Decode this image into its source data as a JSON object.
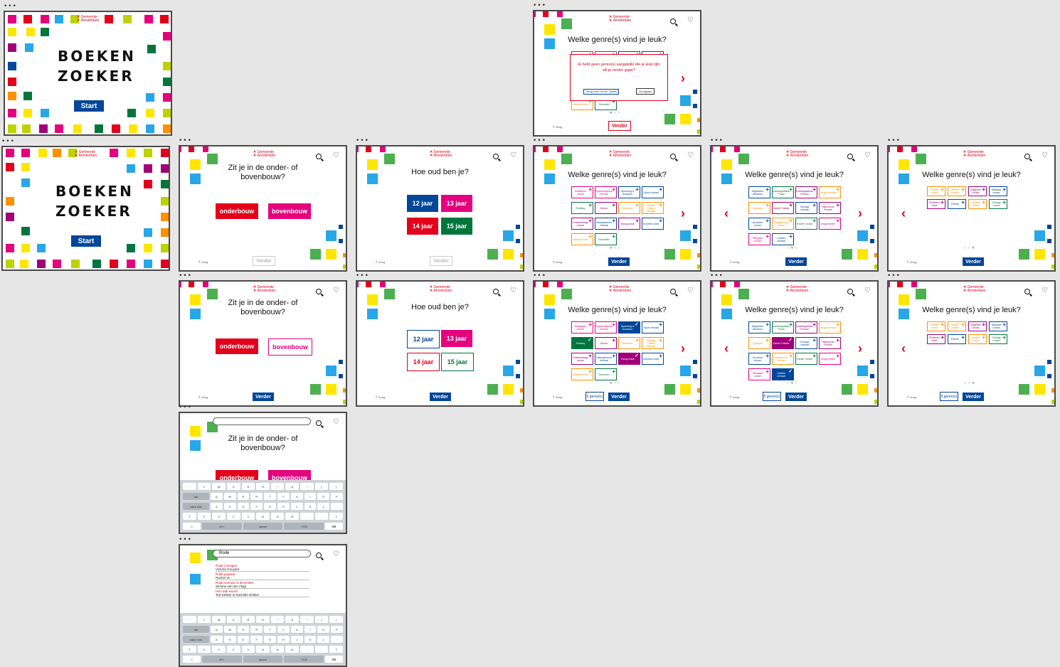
{
  "colors": {
    "red": "#e3001b",
    "blue": "#004699",
    "pink": "#e5007d",
    "green": "#00763d",
    "lightblue": "#009de0",
    "yellow": "#ffe600",
    "lime": "#bed200",
    "orange": "#ff9100",
    "purple": "#a00078",
    "darkgreen": "#4caf50",
    "aqua": "#27a7e7"
  },
  "logo": {
    "line1": "Gemeente",
    "line2": "Amsterdam"
  },
  "brand": {
    "word1": "BOEKEN",
    "word2": "ZOEKER",
    "start": "Start"
  },
  "q_school": "Zit je in de onder- of bovenbouw?",
  "q_age": "Hoe oud ben je?",
  "q_genre": "Welke genre(s) vind je leuk?",
  "btn": {
    "onderbouw": "onderbouw",
    "bovenbouw": "bovenbouw",
    "verder": "Verder",
    "terug": "terug",
    "count": "5 genre(s)"
  },
  "ages": [
    "12 jaar",
    "13 jaar",
    "14 jaar",
    "15 jaar"
  ],
  "genres_p1": [
    "Klassieker roman",
    "Psychologische Roman",
    "Spanning & Avontuur",
    "Sport verhaal",
    "Fantasy",
    "Humor",
    "Detective",
    "Sociaal Politiek Verhaal",
    "Ontwikkelings roman",
    "Waargebeurd verhaal",
    "Young Adult",
    "Voorlees boek",
    "Meisjes boek",
    "Griezelen"
  ],
  "genres_p2": [
    "Migranten literatuur",
    "Autobiografisch Proza",
    "Dubbelgaande Roman",
    "Jeugd verhaal",
    "Dystopie",
    "Dieren Fabels",
    "Oorlogs verhaal",
    "Historische Roman",
    "Avontuur roman",
    "Realistische roman",
    "Kinder roman",
    "Jeugd thriller",
    "Misdaad roman",
    "Liefdes verhaal"
  ],
  "genres_p3": [
    "Familie roman",
    "Ideeën roman",
    "Dagboek roman",
    "Misdaad roman",
    "Probleem boek",
    "Poëzie",
    "Literaire Thriller",
    "Oorlogs roman"
  ],
  "dialog": {
    "message": "Je hebt geen genre(s) aangeklikt die je leuk lijkt, wil je verder gaan?",
    "back": "Terug naar Genre Opties",
    "continue": "Doorgaan"
  },
  "search": {
    "query": "Rode",
    "results": [
      {
        "title": "Rode zonnigen",
        "author": "Victoria Gouyard"
      },
      {
        "title": "Rode pupauw",
        "author": "Rachel Je"
      },
      {
        "title": "Rode sneeuw in december",
        "author": "Simone van der Vlugt"
      },
      {
        "title": "Het rode woord",
        "author": "Ted Dekker & Rachelle Dekker"
      }
    ]
  },
  "kb_rows": [
    [
      "~",
      "1",
      "@",
      "#",
      "$",
      "%",
      "^",
      "&",
      "*",
      "(",
      ")"
    ],
    [
      "tab",
      "Q",
      "W",
      "E",
      "R",
      "T",
      "Y",
      "U",
      "I",
      "O",
      "P"
    ],
    [
      "caps lock",
      "A",
      "S",
      "D",
      "F",
      "G",
      "H",
      "J",
      "K",
      "L",
      "'"
    ],
    [
      "⇧",
      "Z",
      "X",
      "C",
      "V",
      "B",
      "N",
      "M",
      ",",
      ".",
      "⇧"
    ],
    [
      "☺",
      "#+=",
      "space",
      ".?123",
      "⌨"
    ]
  ]
}
